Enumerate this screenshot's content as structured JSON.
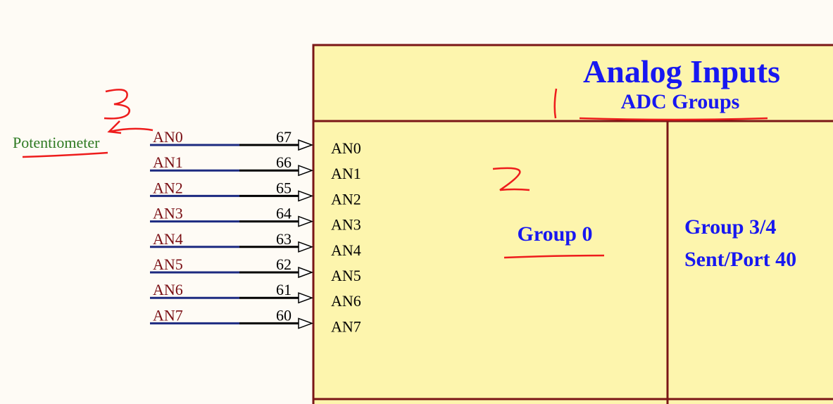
{
  "colors": {
    "background": "#fefbf5",
    "block_fill": "#fdf5ad",
    "block_border": "#7a1616",
    "title": "#1818f0",
    "net_line": "#1c2a80",
    "net_label": "#7a0f14",
    "note": "#2e7a22",
    "annotation": "#ee1c1c"
  },
  "block": {
    "title": "Analog Inputs",
    "subtitle": "ADC Groups",
    "group0_label": "Group 0",
    "group34_line1": "Group 3/4",
    "group34_line2": "Sent/Port 40",
    "inputs": [
      "AN0",
      "AN1",
      "AN2",
      "AN3",
      "AN4",
      "AN5",
      "AN6",
      "AN7"
    ]
  },
  "nets": [
    {
      "label": "AN0",
      "pin": "67"
    },
    {
      "label": "AN1",
      "pin": "66"
    },
    {
      "label": "AN2",
      "pin": "65"
    },
    {
      "label": "AN3",
      "pin": "64"
    },
    {
      "label": "AN4",
      "pin": "63"
    },
    {
      "label": "AN5",
      "pin": "62"
    },
    {
      "label": "AN6",
      "pin": "61"
    },
    {
      "label": "AN7",
      "pin": "60"
    }
  ],
  "annotation": {
    "potentiometer": "Potentiometer",
    "mark_3": "3",
    "mark_2": "2"
  }
}
